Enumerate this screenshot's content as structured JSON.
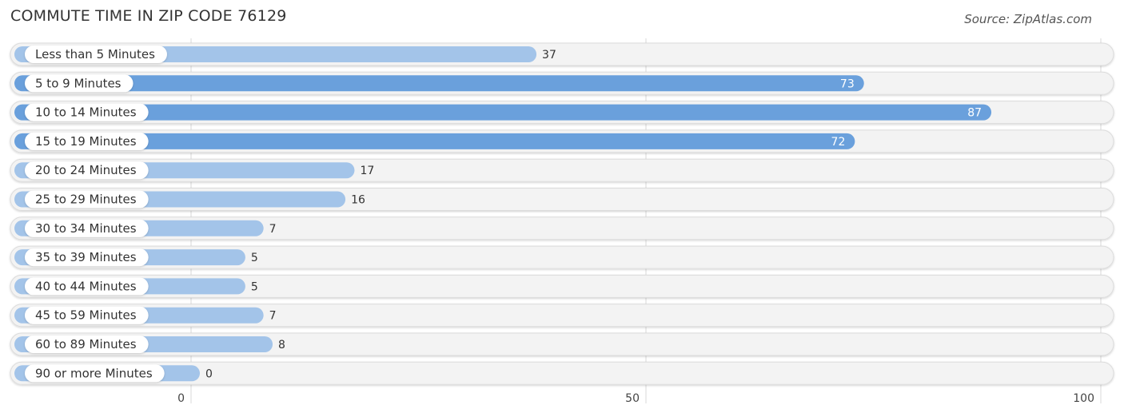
{
  "chart_data": {
    "type": "bar",
    "orientation": "horizontal",
    "title": "COMMUTE TIME IN ZIP CODE 76129",
    "source": "Source: ZipAtlas.com",
    "categories": [
      "Less than 5 Minutes",
      "5 to 9 Minutes",
      "10 to 14 Minutes",
      "15 to 19 Minutes",
      "20 to 24 Minutes",
      "25 to 29 Minutes",
      "30 to 34 Minutes",
      "35 to 39 Minutes",
      "40 to 44 Minutes",
      "45 to 59 Minutes",
      "60 to 89 Minutes",
      "90 or more Minutes"
    ],
    "values": [
      37,
      73,
      87,
      72,
      17,
      16,
      7,
      5,
      5,
      7,
      8,
      0
    ],
    "xlabel": "",
    "ylabel": "",
    "xlim": [
      0,
      100
    ],
    "xticks": [
      0,
      50,
      100
    ],
    "grid": true,
    "legend": "none",
    "colors": {
      "bar_strong": "#6aa0dc",
      "bar_light": "#a3c4e9",
      "track": "#f3f3f3",
      "value_inside": "#ffffff",
      "value_outside": "#333333"
    }
  }
}
